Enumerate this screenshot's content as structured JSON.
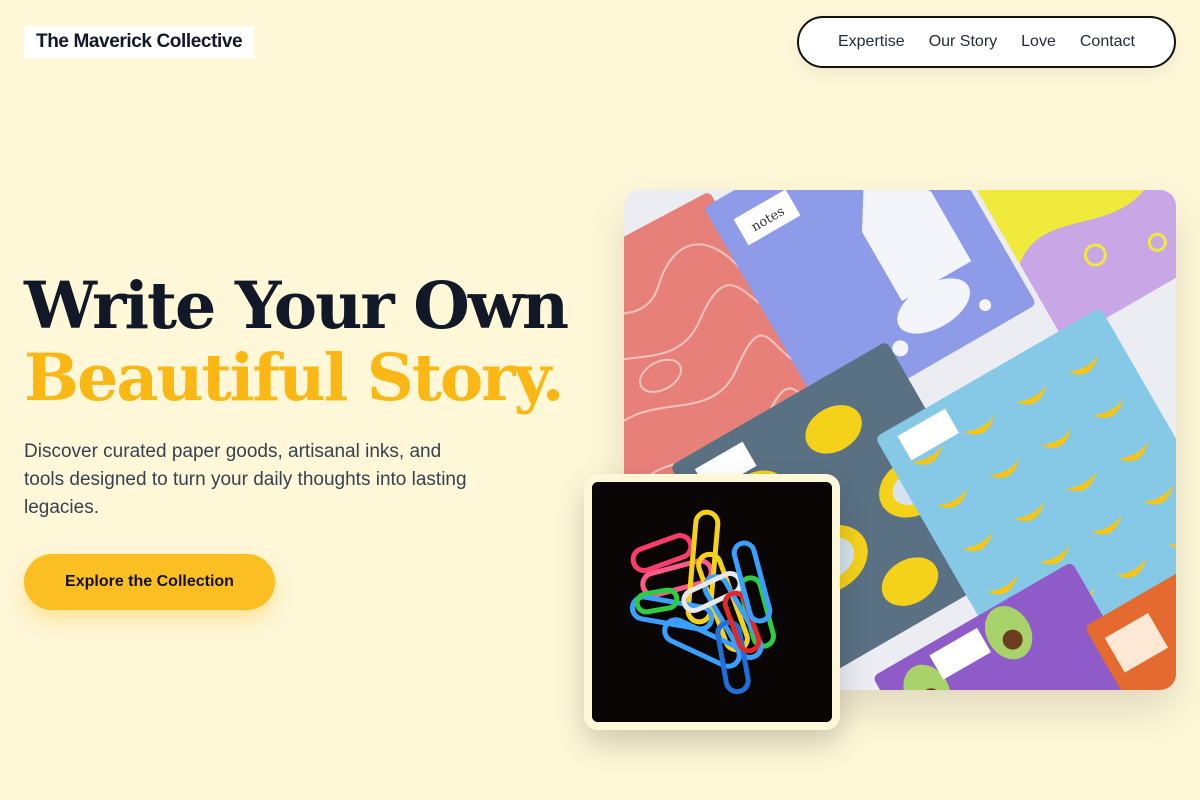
{
  "brand": {
    "name": "The Maverick Collective"
  },
  "nav": {
    "items": [
      "Expertise",
      "Our Story",
      "Love",
      "Contact"
    ]
  },
  "hero": {
    "title_line1": "Write Your Own",
    "title_line2": "Beautiful Story.",
    "description": "Discover curated paper goods, artisanal inks, and tools designed to turn your daily thoughts into lasting legacies.",
    "cta_label": "Explore the Collection"
  },
  "images": {
    "notebook_label": "notes"
  },
  "colors": {
    "background": "#fef7d8",
    "accent": "#fbb714",
    "button": "#fbbf24",
    "text_dark": "#111827"
  }
}
